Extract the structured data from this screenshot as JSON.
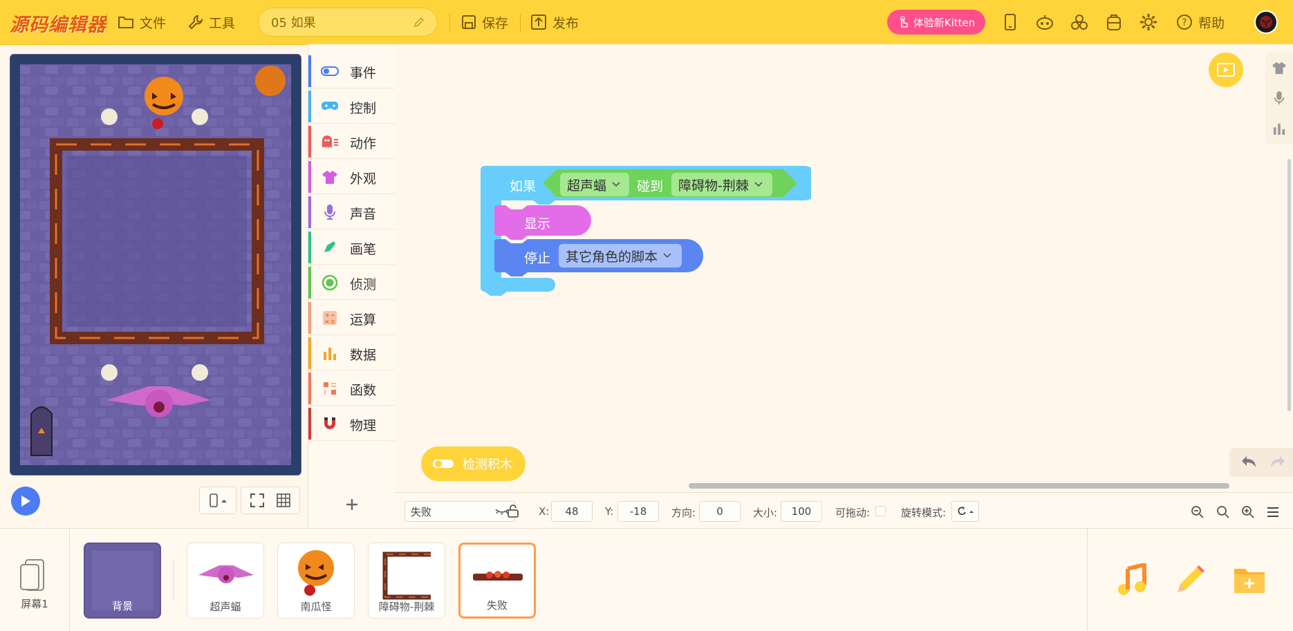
{
  "topbar": {
    "logo": "源码编辑器",
    "file": "文件",
    "tools": "工具",
    "project_name": "05 如果",
    "save": "保存",
    "publish": "发布",
    "kitten": "体验新Kitten",
    "help": "帮助"
  },
  "categories": [
    {
      "label": "事件",
      "color": "#4c7bf3"
    },
    {
      "label": "控制",
      "color": "#47b3f5"
    },
    {
      "label": "动作",
      "color": "#f05a5a"
    },
    {
      "label": "外观",
      "color": "#d55be0"
    },
    {
      "label": "声音",
      "color": "#9a6be0"
    },
    {
      "label": "画笔",
      "color": "#28c28a"
    },
    {
      "label": "侦测",
      "color": "#5cc654"
    },
    {
      "label": "运算",
      "color": "#f2a07a"
    },
    {
      "label": "数据",
      "color": "#f5a623"
    },
    {
      "label": "函数",
      "color": "#f07a5a"
    },
    {
      "label": "物理",
      "color": "#d03a3a"
    }
  ],
  "blocks": {
    "if_label": "如果",
    "sprite_dropdown": "超声蝠",
    "touch_label": "碰到",
    "target_dropdown": "障碍物-荆棘",
    "show_label": "显示",
    "stop_label": "停止",
    "stop_dropdown": "其它角色的脚本"
  },
  "workspace": {
    "check_blocks": "检测积木"
  },
  "properties": {
    "sprite_name": "失败",
    "x_label": "X:",
    "x_value": "48",
    "y_label": "Y:",
    "y_value": "-18",
    "direction_label": "方向:",
    "direction_value": "0",
    "size_label": "大小:",
    "size_value": "100",
    "draggable_label": "可拖动:",
    "rotation_label": "旋转模式:"
  },
  "tray": {
    "screen_label": "屏幕1",
    "sprites": [
      {
        "name": "背景"
      },
      {
        "name": "超声蝠"
      },
      {
        "name": "南瓜怪"
      },
      {
        "name": "障碍物-荆棘"
      },
      {
        "name": "失败"
      }
    ]
  },
  "colors": {
    "topbar": "#ffd43b",
    "control_block": "#68cdfa",
    "sensing_block": "#6fd35a",
    "looks_block": "#e36ce8",
    "events_block": "#5b86f2",
    "kitten_button": "#ff4f8a"
  }
}
